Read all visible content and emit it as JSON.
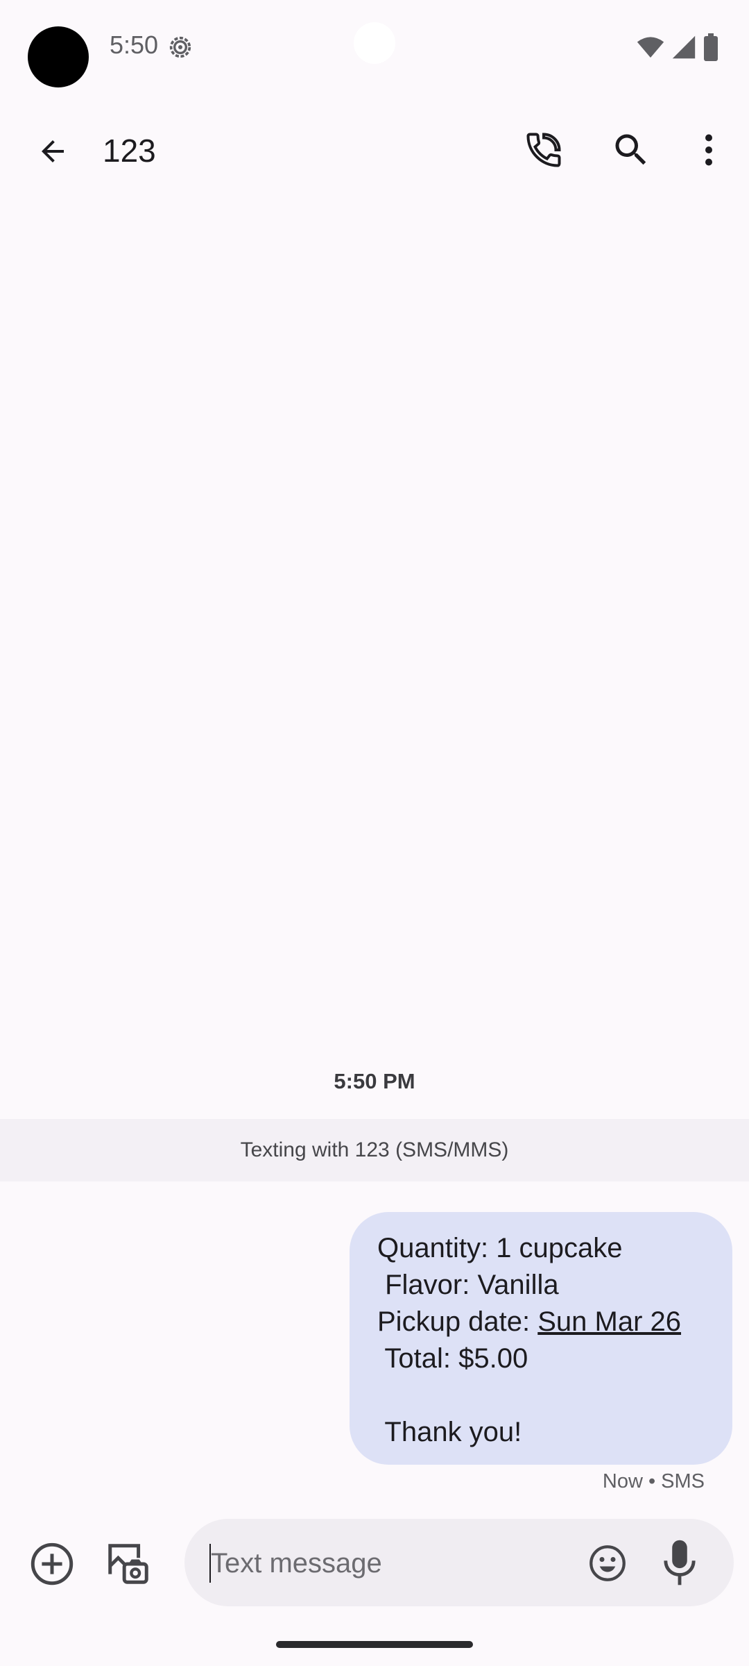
{
  "status_bar": {
    "time": "5:50"
  },
  "app_bar": {
    "title": "123"
  },
  "conversation": {
    "timestamp": "5:50 PM",
    "banner": "Texting with 123 (SMS/MMS)",
    "message": {
      "line1": "Quantity: 1 cupcake",
      "line2": " Flavor: Vanilla",
      "line3_prefix": "Pickup date: ",
      "line3_link": "Sun Mar 26",
      "line4": " Total: $5.00",
      "line5": "",
      "line6": " Thank you!"
    },
    "meta": "Now • SMS"
  },
  "compose": {
    "placeholder": "Text message",
    "value": ""
  },
  "colors": {
    "background": "#fcf9fc",
    "bubble": "#dde1f6",
    "banner": "#f3f0f5",
    "compose": "#f0edf2"
  },
  "icons": [
    "back-arrow-icon",
    "phone-icon",
    "search-icon",
    "more-vert-icon",
    "add-circle-icon",
    "gallery-icon",
    "emoji-icon",
    "mic-icon",
    "gear-icon",
    "wifi-icon",
    "signal-icon",
    "battery-icon"
  ]
}
